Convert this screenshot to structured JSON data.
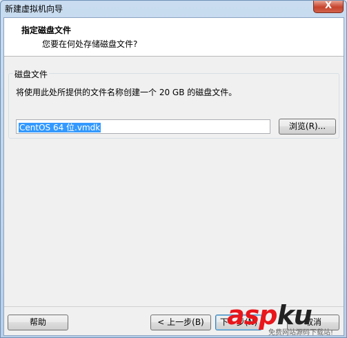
{
  "window": {
    "title": "新建虚拟机向导",
    "close_glyph": "X"
  },
  "header": {
    "title": "指定磁盘文件",
    "subtitle": "您要在何处存储磁盘文件?"
  },
  "disk_group": {
    "legend": "磁盘文件",
    "description": "将使用此处所提供的文件名称创建一个 20 GB 的磁盘文件。",
    "file_name": "CentOS 64 位.vmdk",
    "browse_label": "浏览(R)..."
  },
  "footer": {
    "help_label": "帮助",
    "back_label": "< 上一步(B)",
    "next_label": "下一步(N)",
    "cancel_label": "取消"
  },
  "watermark": {
    "logo_left": "asp",
    "logo_mid": "ku",
    "logo_suffix": ".com",
    "tagline": "免费网站源码下载站!"
  }
}
